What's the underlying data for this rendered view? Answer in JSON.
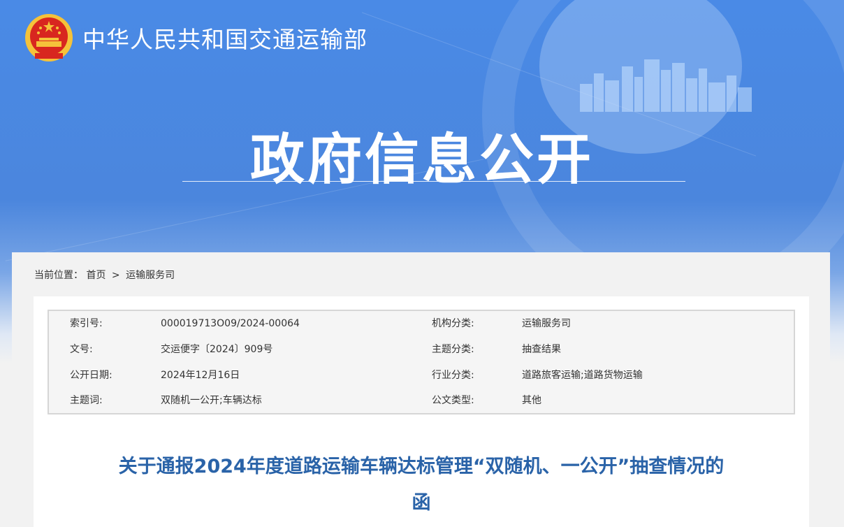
{
  "header": {
    "site_title": "中华人民共和国交通运输部",
    "section_title": "政府信息公开"
  },
  "breadcrumb": {
    "label": "当前位置：",
    "items": [
      "首页",
      "运输服务司"
    ],
    "separator": ">"
  },
  "meta": [
    {
      "k1": "索引号:",
      "v1": "000019713O09/2024-00064",
      "k2": "机构分类:",
      "v2": "运输服务司"
    },
    {
      "k1": "文号:",
      "v1": "交运便字〔2024〕909号",
      "k2": "主题分类:",
      "v2": "抽查结果"
    },
    {
      "k1": "公开日期:",
      "v1": "2024年12月16日",
      "k2": "行业分类:",
      "v2": "道路旅客运输;道路货物运输"
    },
    {
      "k1": "主题词:",
      "v1": "双随机一公开;车辆达标",
      "k2": "公文类型:",
      "v2": "其他"
    }
  ],
  "document": {
    "title_line1": "关于通报2024年度道路运输车辆达标管理“双随机、一公开”抽查情况的",
    "title_line2": "函"
  },
  "colors": {
    "banner_blue": "#4a8ae6",
    "title_blue": "#2a63a8"
  },
  "icons": [
    "national-emblem-icon"
  ]
}
